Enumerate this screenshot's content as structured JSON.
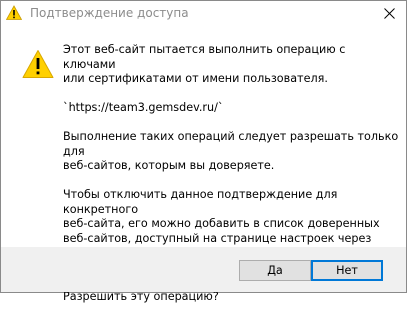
{
  "window": {
    "title": "Подтверждение доступа"
  },
  "icons": {
    "title_icon": "warning-icon",
    "close_icon": "close-icon",
    "message_icon": "warning-triangle-icon"
  },
  "message": {
    "paragraphs": [
      "Этот веб-сайт пытается выполнить операцию с ключами\nили сертификатами от имени пользователя.",
      "  `https://team3.gemsdev.ru/`",
      "Выполнение таких операций следует разрешать только для\nвеб-сайтов, которым вы доверяете.",
      "Чтобы отключить данное подтверждение для конкретного\nвеб-сайта, его можно добавить в список доверенных\nвеб-сайтов, доступный на странице настроек через меню\nПуск-> КРИПТО-ПРО-> Настройки ЭЦП Browser plug-in.",
      "Разрешить эту операцию?"
    ]
  },
  "buttons": {
    "yes_label": "Да",
    "no_label": "Нет"
  },
  "colors": {
    "title_text": "#8c8c8c",
    "warning_yellow": "#ffd000",
    "footer_bg": "#f0f0f0",
    "default_button_border": "#0078d7"
  }
}
